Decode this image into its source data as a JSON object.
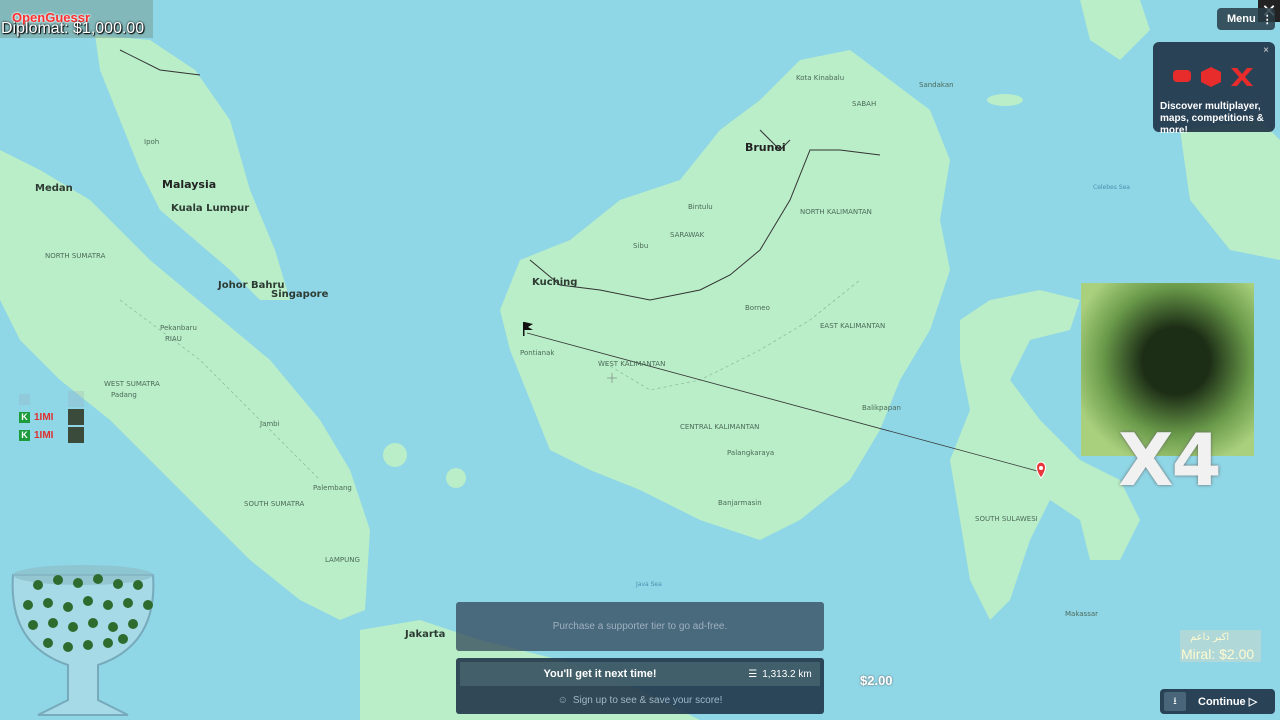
{
  "app": {
    "logo": "OpenGuessr",
    "diplomat": "Diplomat: $1,000.00"
  },
  "top_right": {
    "close": "✕",
    "menu_label": "Menu",
    "menu_dots": "⋮"
  },
  "promo": {
    "close": "×",
    "text": "Discover multiplayer, maps, competitions & more!"
  },
  "overlay": {
    "multiplier": "X4"
  },
  "players": [
    {
      "badge": "K",
      "name": "1IMI"
    },
    {
      "badge": "K",
      "name": "1IMI"
    }
  ],
  "ad_banner": "Purchase a supporter tier to go ad-free.",
  "result": {
    "message": "You'll get it next time!",
    "distance": "1,313.2 km",
    "signup": "Sign up to see & save your score!"
  },
  "bottom_dollar": "$2.00",
  "miral": {
    "arabic": "اكبر داعم",
    "value": "Miral: $2.00"
  },
  "continue": {
    "label": "Continue",
    "icon": "▷"
  },
  "map_labels": {
    "malaysia": "Malaysia",
    "brunei": "Brunei",
    "kuching": "Kuching",
    "kuala_lumpur": "Kuala Lumpur",
    "singapore": "Singapore",
    "johor": "Johor Bahru",
    "medan": "Medan",
    "pekanbaru": "Pekanbaru",
    "padang": "Padang",
    "jambi": "Jambi",
    "palembang": "Palembang",
    "jakarta": "Jakarta",
    "pontianak": "Pontianak",
    "balikpapan": "Balikpapan",
    "banjarmasin": "Banjarmasin",
    "palangkaraya": "Palangkaraya",
    "makassar": "Makassar",
    "ipoh": "Ipoh",
    "sibu": "Sibu",
    "bintulu": "Bintulu",
    "kota_kinabalu": "Kota Kinabalu",
    "sandakan": "Sandakan",
    "west_kalimantan": "WEST KALIMANTAN",
    "central_kalimantan": "CENTRAL KALIMANTAN",
    "east_kalimantan": "EAST KALIMANTAN",
    "north_kalimantan": "NORTH KALIMANTAN",
    "south_sulawesi": "SOUTH SULAWESI",
    "west_sumatra": "WEST SUMATRA",
    "south_sumatra": "SOUTH SUMATRA",
    "north_sumatra": "NORTH SUMATRA",
    "riau": "RIAU",
    "sarawak": "SARAWAK",
    "sabah": "SABAH",
    "borneo": "Borneo",
    "lampung": "LAMPUNG",
    "celebes_sea": "Celebes Sea",
    "java_sea": "Java Sea"
  },
  "colors": {
    "water": "#8fd6e6",
    "land": "#b9eec8",
    "guess_line": "#333333",
    "marker": "#e8363a"
  }
}
